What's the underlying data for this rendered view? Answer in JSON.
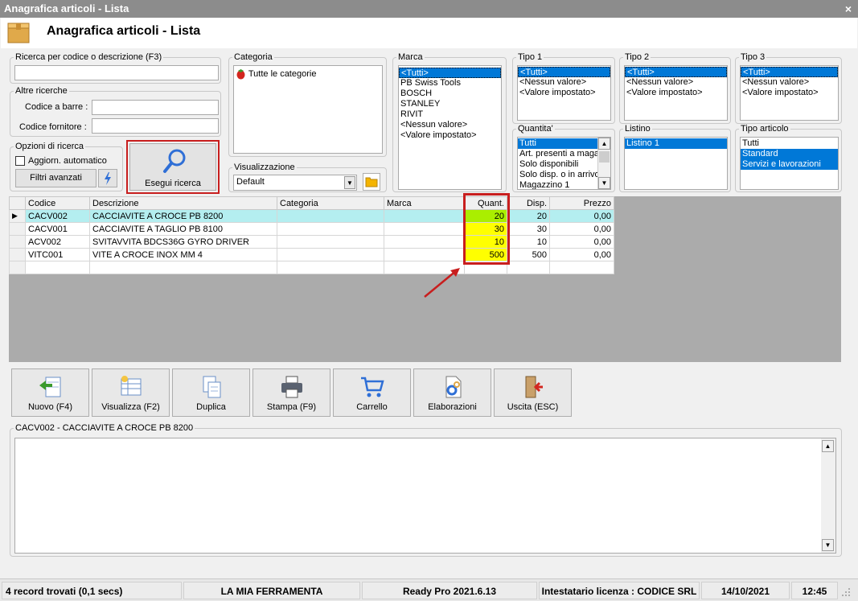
{
  "window": {
    "title": "Anagrafica articoli  - Lista",
    "close_label": "×"
  },
  "header": {
    "title": "Anagrafica articoli  - Lista"
  },
  "search": {
    "label": "Ricerca per codice o descrizione (F3)",
    "value": "",
    "other_label": "Altre ricerche",
    "barcode_label": "Codice a barre :",
    "supplier_label": "Codice fornitore :",
    "options_label": "Opzioni di ricerca",
    "auto_update_label": "Aggiorn. automatico",
    "advanced_filters_label": "Filtri avanzati",
    "search_button_label": "Esegui ricerca"
  },
  "categoria": {
    "label": "Categoria",
    "items": [
      "Tutte le categorie"
    ]
  },
  "visualizzazione": {
    "label": "Visualizzazione",
    "value": "Default"
  },
  "marca": {
    "label": "Marca",
    "items": [
      "<Tutti>",
      "PB Swiss Tools",
      "BOSCH",
      "STANLEY",
      "RIVIT",
      "<Nessun valore>",
      "<Valore impostato>"
    ]
  },
  "tipo1": {
    "label": "Tipo 1",
    "items": [
      "<Tutti>",
      "<Nessun valore>",
      "<Valore impostato>"
    ]
  },
  "tipo2": {
    "label": "Tipo 2",
    "items": [
      "<Tutti>",
      "<Nessun valore>",
      "<Valore impostato>"
    ]
  },
  "tipo3": {
    "label": "Tipo 3",
    "items": [
      "<Tutti>",
      "<Nessun valore>",
      "<Valore impostato>"
    ]
  },
  "quantita": {
    "label": "Quantita'",
    "items": [
      "Tutti",
      "Art. presenti a magazzino",
      "Solo disponibili",
      "Solo disp. o in arrivo",
      "Magazzino 1"
    ]
  },
  "listino": {
    "label": "Listino",
    "items": [
      "Listino 1"
    ]
  },
  "tipo_articolo": {
    "label": "Tipo articolo",
    "items": [
      "Tutti",
      "Standard",
      "Servizi e lavorazioni"
    ]
  },
  "grid": {
    "headers": [
      "Codice",
      "Descrizione",
      "Categoria",
      "Marca",
      "Quant.",
      "Disp.",
      "Prezzo"
    ],
    "rows": [
      [
        "CACV002",
        "CACCIAVITE A CROCE PB 8200",
        "",
        "",
        "20",
        "20",
        "0,00"
      ],
      [
        "CACV001",
        "CACCIAVITE A TAGLIO PB 8100",
        "",
        "",
        "30",
        "30",
        "0,00"
      ],
      [
        "ACV002",
        "SVITAVVITA BDCS36G GYRO DRIVER",
        "",
        "",
        "10",
        "10",
        "0,00"
      ],
      [
        "VITC001",
        "VITE A CROCE INOX MM 4",
        "",
        "",
        "500",
        "500",
        "0,00"
      ]
    ]
  },
  "toolbar": [
    {
      "label": "Nuovo (F4)",
      "icon": "new-record-icon"
    },
    {
      "label": "Visualizza (F2)",
      "icon": "view-icon"
    },
    {
      "label": "Duplica",
      "icon": "duplicate-icon"
    },
    {
      "label": "Stampa (F9)",
      "icon": "printer-icon"
    },
    {
      "label": "Carrello",
      "icon": "cart-icon"
    },
    {
      "label": "Elaborazioni",
      "icon": "gear-document-icon"
    },
    {
      "label": "Uscita (ESC)",
      "icon": "exit-icon"
    }
  ],
  "detail": {
    "label": "CACV002 - CACCIAVITE A CROCE PB 8200",
    "text": ""
  },
  "status": {
    "records": "4 record trovati (0,1 secs)",
    "company": "LA MIA FERRAMENTA",
    "version": "Ready Pro 2021.6.13",
    "license": "Intestatario licenza : CODICE SRL",
    "date": "14/10/2021",
    "time": "12:45"
  },
  "colors": {
    "selected_row": "#b4eef0",
    "selected_item": "#0078d7",
    "highlight_border": "#c81e1e",
    "qty_green": "#aaee00",
    "qty_yellow": "#ffff00"
  }
}
